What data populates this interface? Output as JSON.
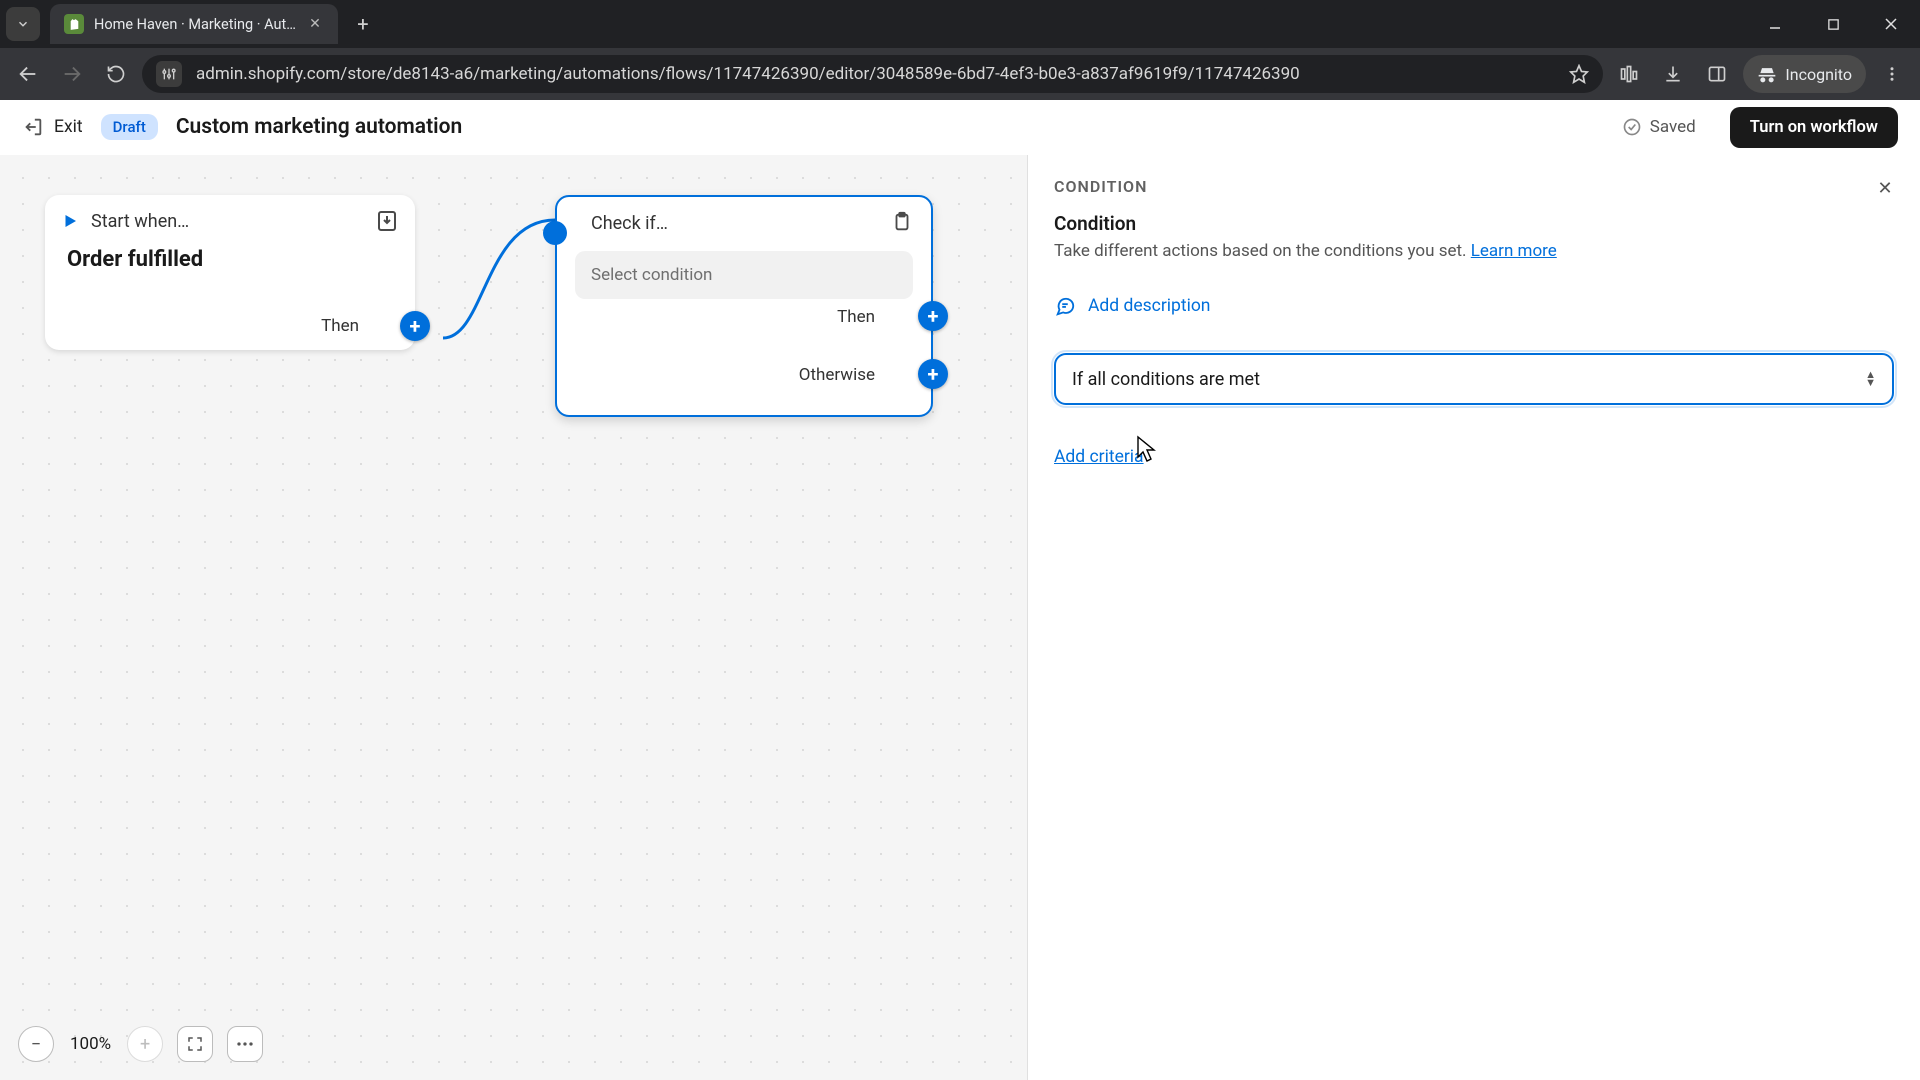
{
  "browser": {
    "tab_title": "Home Haven · Marketing · Aut…",
    "url": "admin.shopify.com/store/de8143-a6/marketing/automations/flows/11747426390/editor/3048589e-6bd7-4ef3-b0e3-a837af9619f9/11747426390",
    "incognito_label": "Incognito"
  },
  "header": {
    "exit": "Exit",
    "badge": "Draft",
    "title": "Custom marketing automation",
    "saved": "Saved",
    "turn_on": "Turn on workflow"
  },
  "canvas": {
    "trigger": {
      "head": "Start when…",
      "body": "Order fulfilled",
      "then": "Then"
    },
    "condition": {
      "head": "Check if…",
      "placeholder": "Select condition",
      "then": "Then",
      "otherwise": "Otherwise"
    },
    "zoom": "100%"
  },
  "panel": {
    "eyebrow": "CONDITION",
    "title": "Condition",
    "sub_pre": "Take different actions based on the conditions you set. ",
    "sub_link": "Learn more",
    "add_desc": "Add description",
    "select_value": "If all conditions are met",
    "add_criteria": "Add criteria"
  }
}
